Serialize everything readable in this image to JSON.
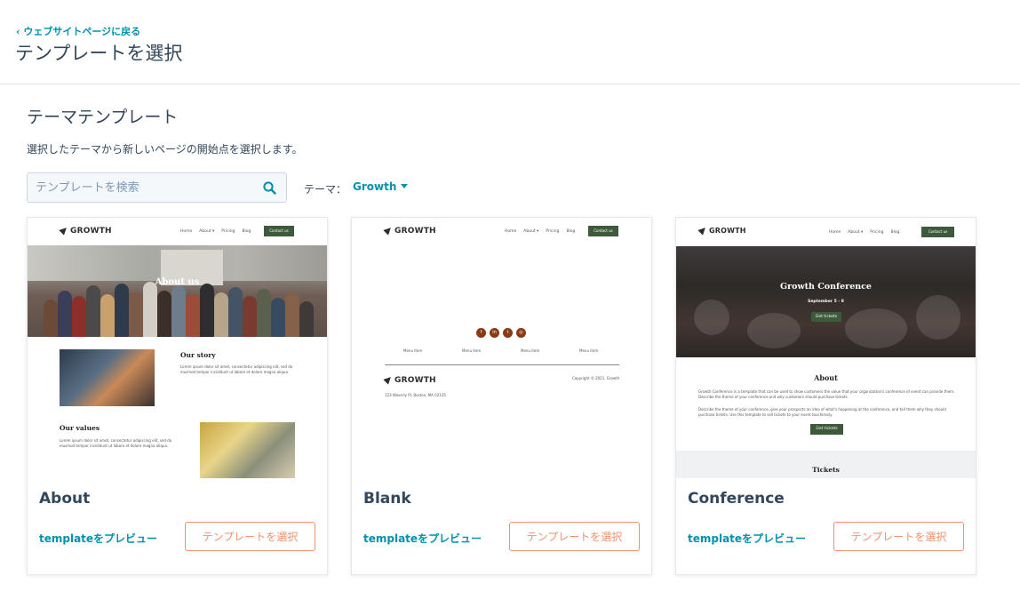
{
  "header": {
    "back_label": "‹  ウェブサイトページに戻る",
    "title": "テンプレートを選択"
  },
  "section": {
    "title": "テーマテンプレート",
    "description": "選択したテーマから新しいページの開始点を選択します。"
  },
  "search": {
    "placeholder": "テンプレートを検索",
    "icon": "search-icon"
  },
  "theme": {
    "label": "テーマ：",
    "value": "Growth"
  },
  "colors": {
    "accent": "#0091ae",
    "select_button": "#f2916f",
    "heading": "#33475b",
    "site_green": "#3d5a3a"
  },
  "preview_site": {
    "logo": "GROWTH",
    "nav": [
      "Home",
      "About ▾",
      "Pricing",
      "Blog"
    ],
    "cta": "Contact us"
  },
  "cards": [
    {
      "name": "About",
      "preview_link": "templateをプレビュー",
      "select_label": "テンプレートを選択",
      "thumb": {
        "hero_title": "About us",
        "story_title": "Our story",
        "story_text": "Lorem ipsum dolor sit amet, consectetur adipiscing elit, sed do eiusmod tempor incididunt ut labore et dolore magna aliqua.",
        "values_title": "Our values",
        "values_text": "Lorem ipsum dolor sit amet, consectetur adipiscing elit, sed do eiusmod tempor incididunt ut labore et dolore magna aliqua."
      }
    },
    {
      "name": "Blank",
      "preview_link": "templateをプレビュー",
      "select_label": "テンプレートを選択",
      "thumb": {
        "social": [
          "f",
          "in",
          "t",
          "◎"
        ],
        "menu_items": [
          "Menu item",
          "Menu item",
          "Menu item",
          "Menu item"
        ],
        "copyright": "Copyright © 2021. Growth",
        "address": "123 Waverly Pl, Boston, MA 02135"
      }
    },
    {
      "name": "Conference",
      "preview_link": "templateをプレビュー",
      "select_label": "テンプレートを選択",
      "thumb": {
        "hero_title": "Growth Conference",
        "hero_date": "September 5 - 8",
        "hero_button": "Get tickets",
        "about_title": "About",
        "about_text_1": "Growth Conference is a template that can be used to show customers the value that your organization's conference of event can provide them. Describe the theme of your conference and why customers should purchase tickets.",
        "about_text_2": "Describe the theme of your conference, give your prospects an idea of what's happening at the conference, and tell them why they should purchase tickets. Use this template to sell tickets to your event touchlessly.",
        "about_button": "Get tickets",
        "tickets_title": "Tickets"
      }
    }
  ]
}
